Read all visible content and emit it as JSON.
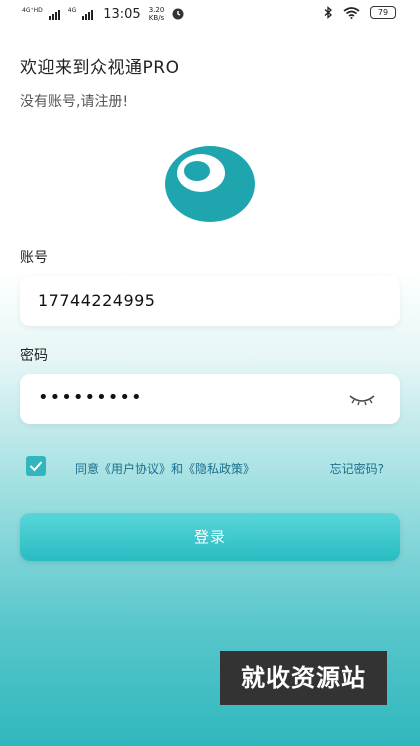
{
  "status_bar": {
    "network_1": "4G⁺HD",
    "network_2": "4G",
    "time": "13:05",
    "speed_value": "3.20",
    "speed_unit": "KB/s",
    "battery": "79",
    "icons": [
      "signal-icon",
      "timer-icon",
      "bluetooth-icon",
      "wifi-icon",
      "battery-icon"
    ]
  },
  "header": {
    "welcome": "欢迎来到众视通PRO",
    "register_prompt": "没有账号,请注册!"
  },
  "form": {
    "account_label": "账号",
    "account_value": "17744224995",
    "password_label": "密码",
    "password_masked": "•••••••••",
    "agreement_text": "同意《用户协议》和《隐私政策》",
    "forgot_password": "忘记密码?",
    "login_button": "登录",
    "checkbox_checked": true
  },
  "watermark": {
    "text": "就收资源站"
  },
  "colors": {
    "accent": "#2fb7bd",
    "link": "#1c6f8c"
  }
}
